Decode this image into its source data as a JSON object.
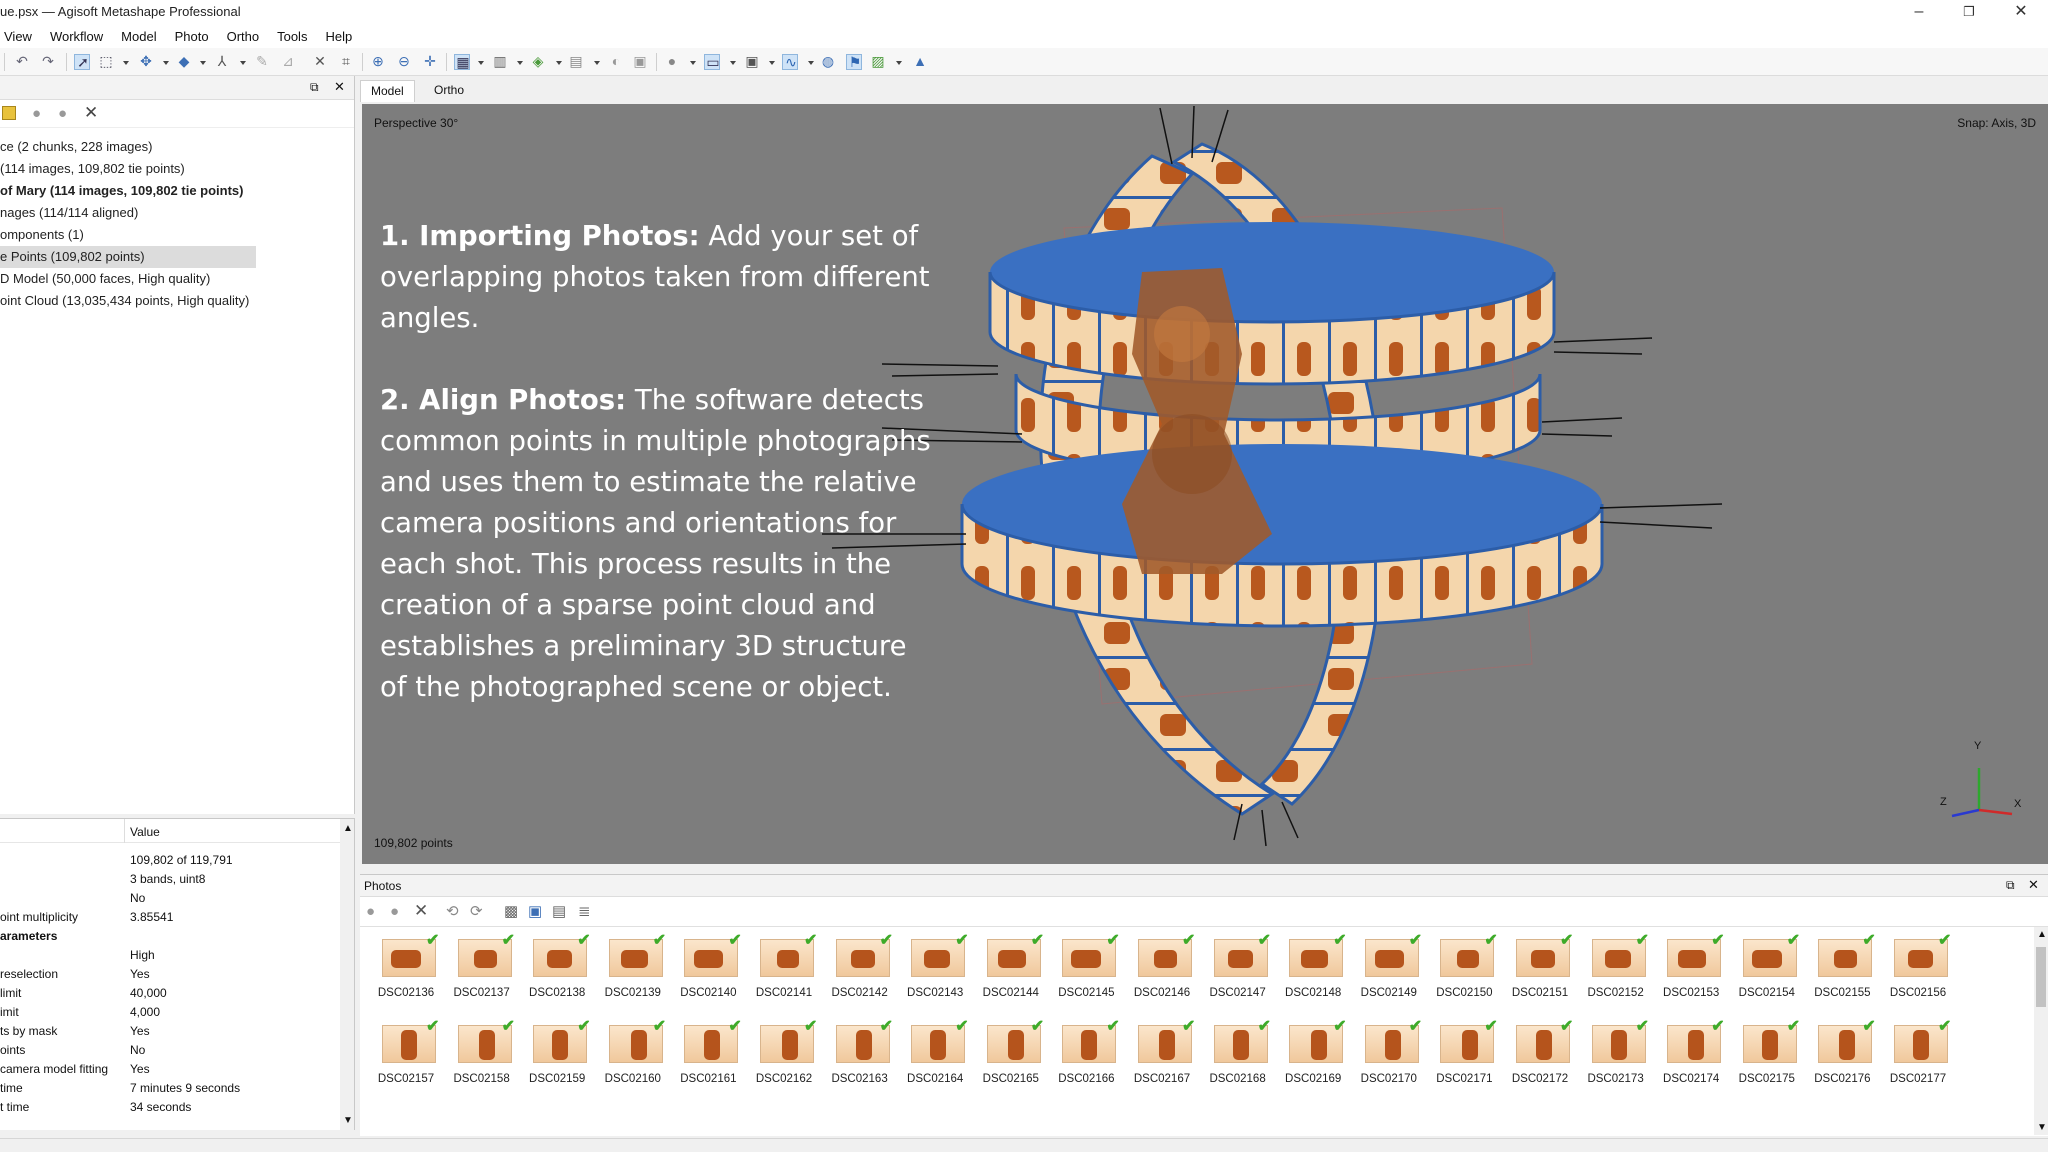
{
  "window": {
    "title": "ue.psx — Agisoft Metashape Professional",
    "minimize": "–",
    "restore": "❐",
    "close": "✕"
  },
  "menu": [
    "View",
    "Workflow",
    "Model",
    "Photo",
    "Ortho",
    "Tools",
    "Help"
  ],
  "toolbar_icons": [
    "undo-icon",
    "redo-icon",
    "select-icon",
    "rect-select-icon",
    "navigate-icon",
    "move-icon",
    "rotate-icon",
    "brush-icon",
    "ruler-icon",
    "delete-icon",
    "crop-icon",
    "zoom-in-icon",
    "zoom-out-icon",
    "pan-icon",
    "grid-view-icon",
    "columns-icon",
    "shape-icon",
    "render-icon",
    "texture-icon",
    "shading-icon",
    "sphere-icon",
    "camera-view-icon",
    "monitor-icon",
    "curve-icon",
    "globe-icon",
    "flag-icon",
    "image-icon",
    "export-icon"
  ],
  "workspace": {
    "tree": [
      {
        "text": "ce (2 chunks, 228 images)",
        "bold": false,
        "selected": false
      },
      {
        "text": "(114 images, 109,802 tie points)",
        "bold": false,
        "selected": false
      },
      {
        "text": "of Mary (114 images, 109,802 tie points)",
        "bold": true,
        "selected": false
      },
      {
        "text": "nages (114/114 aligned)",
        "bold": false,
        "selected": false
      },
      {
        "text": "omponents (1)",
        "bold": false,
        "selected": false
      },
      {
        "text": "e Points (109,802 points)",
        "bold": false,
        "selected": true
      },
      {
        "text": "D Model (50,000 faces, High quality)",
        "bold": false,
        "selected": false
      },
      {
        "text": "oint Cloud (13,035,434 points, High quality)",
        "bold": false,
        "selected": false
      }
    ]
  },
  "properties": {
    "value_header": "Value",
    "rows": [
      {
        "k": "",
        "v": "109,802 of 119,791",
        "section": false
      },
      {
        "k": "",
        "v": "3 bands, uint8",
        "section": false
      },
      {
        "k": "",
        "v": "No",
        "section": false
      },
      {
        "k": "oint multiplicity",
        "v": "3.85541",
        "section": false
      },
      {
        "k": "arameters",
        "v": "",
        "section": true
      },
      {
        "k": "",
        "v": "High",
        "section": false
      },
      {
        "k": "reselection",
        "v": "Yes",
        "section": false
      },
      {
        "k": "limit",
        "v": "40,000",
        "section": false
      },
      {
        "k": "imit",
        "v": "4,000",
        "section": false
      },
      {
        "k": "ts by mask",
        "v": "Yes",
        "section": false
      },
      {
        "k": "oints",
        "v": "No",
        "section": false
      },
      {
        "k": "camera model fitting",
        "v": "Yes",
        "section": false
      },
      {
        "k": "time",
        "v": "7 minutes 9 seconds",
        "section": false
      },
      {
        "k": "t time",
        "v": "34 seconds",
        "section": false
      }
    ]
  },
  "tabs": [
    "Model",
    "Ortho"
  ],
  "viewport": {
    "perspective": "Perspective 30°",
    "snap": "Snap: Axis, 3D",
    "points": "109,802 points",
    "axis_y": "Y",
    "axis_x": "X",
    "axis_z": "Z"
  },
  "overlay": {
    "p1_head": "1. Importing Photos:",
    "p1_body": " Add your set of overlapping photos taken from different angles.",
    "p2_head": "2. Align Photos:",
    "p2_body": " The software detects common points in multiple photographs and uses them to estimate the relative camera positions and orientations for each shot. This process results in the creation of a sparse point cloud and establishes a preliminary 3D structure of the photographed scene or object."
  },
  "photos": {
    "title": "Photos",
    "row1": [
      "DSC02136",
      "DSC02137",
      "DSC02138",
      "DSC02139",
      "DSC02140",
      "DSC02141",
      "DSC02142",
      "DSC02143",
      "DSC02144",
      "DSC02145",
      "DSC02146",
      "DSC02147",
      "DSC02148",
      "DSC02149",
      "DSC02150",
      "DSC02151",
      "DSC02152",
      "DSC02153",
      "DSC02154",
      "DSC02155",
      "DSC02156"
    ],
    "row2": [
      "DSC02157",
      "DSC02158",
      "DSC02159",
      "DSC02160",
      "DSC02161",
      "DSC02162",
      "DSC02163",
      "DSC02164",
      "DSC02165",
      "DSC02166",
      "DSC02167",
      "DSC02168",
      "DSC02169",
      "DSC02170",
      "DSC02171",
      "DSC02172",
      "DSC02173",
      "DSC02174",
      "DSC02175",
      "DSC02176",
      "DSC02177"
    ]
  }
}
